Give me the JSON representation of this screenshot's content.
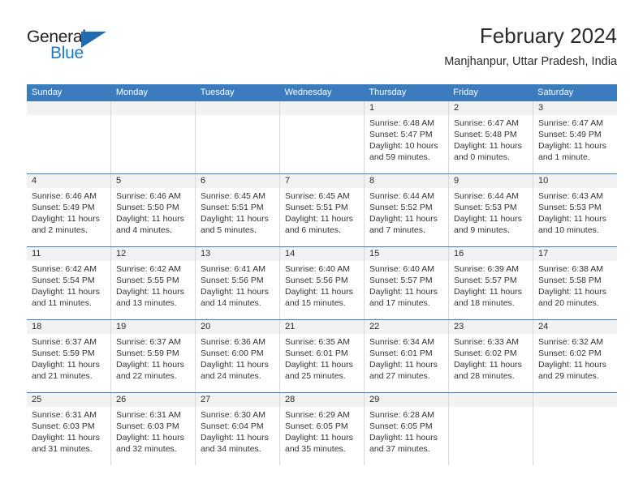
{
  "brand": {
    "name_top": "General",
    "name_bottom": "Blue",
    "accent_color": "#1f7ac4",
    "triangle_color": "#1f6cb4"
  },
  "header": {
    "title": "February 2024",
    "location": "Manjhanpur, Uttar Pradesh, India"
  },
  "theme": {
    "header_blue": "#3a7cbe",
    "daynum_band": "#f2f2f2",
    "cell_border": "#d9d9d9",
    "text": "#333333"
  },
  "weekdays": [
    "Sunday",
    "Monday",
    "Tuesday",
    "Wednesday",
    "Thursday",
    "Friday",
    "Saturday"
  ],
  "weeks": [
    [
      {
        "day": "",
        "sunrise": "",
        "sunset": "",
        "daylight_1": "",
        "daylight_2": ""
      },
      {
        "day": "",
        "sunrise": "",
        "sunset": "",
        "daylight_1": "",
        "daylight_2": ""
      },
      {
        "day": "",
        "sunrise": "",
        "sunset": "",
        "daylight_1": "",
        "daylight_2": ""
      },
      {
        "day": "",
        "sunrise": "",
        "sunset": "",
        "daylight_1": "",
        "daylight_2": ""
      },
      {
        "day": "1",
        "sunrise": "Sunrise: 6:48 AM",
        "sunset": "Sunset: 5:47 PM",
        "daylight_1": "Daylight: 10 hours",
        "daylight_2": "and 59 minutes."
      },
      {
        "day": "2",
        "sunrise": "Sunrise: 6:47 AM",
        "sunset": "Sunset: 5:48 PM",
        "daylight_1": "Daylight: 11 hours",
        "daylight_2": "and 0 minutes."
      },
      {
        "day": "3",
        "sunrise": "Sunrise: 6:47 AM",
        "sunset": "Sunset: 5:49 PM",
        "daylight_1": "Daylight: 11 hours",
        "daylight_2": "and 1 minute."
      }
    ],
    [
      {
        "day": "4",
        "sunrise": "Sunrise: 6:46 AM",
        "sunset": "Sunset: 5:49 PM",
        "daylight_1": "Daylight: 11 hours",
        "daylight_2": "and 2 minutes."
      },
      {
        "day": "5",
        "sunrise": "Sunrise: 6:46 AM",
        "sunset": "Sunset: 5:50 PM",
        "daylight_1": "Daylight: 11 hours",
        "daylight_2": "and 4 minutes."
      },
      {
        "day": "6",
        "sunrise": "Sunrise: 6:45 AM",
        "sunset": "Sunset: 5:51 PM",
        "daylight_1": "Daylight: 11 hours",
        "daylight_2": "and 5 minutes."
      },
      {
        "day": "7",
        "sunrise": "Sunrise: 6:45 AM",
        "sunset": "Sunset: 5:51 PM",
        "daylight_1": "Daylight: 11 hours",
        "daylight_2": "and 6 minutes."
      },
      {
        "day": "8",
        "sunrise": "Sunrise: 6:44 AM",
        "sunset": "Sunset: 5:52 PM",
        "daylight_1": "Daylight: 11 hours",
        "daylight_2": "and 7 minutes."
      },
      {
        "day": "9",
        "sunrise": "Sunrise: 6:44 AM",
        "sunset": "Sunset: 5:53 PM",
        "daylight_1": "Daylight: 11 hours",
        "daylight_2": "and 9 minutes."
      },
      {
        "day": "10",
        "sunrise": "Sunrise: 6:43 AM",
        "sunset": "Sunset: 5:53 PM",
        "daylight_1": "Daylight: 11 hours",
        "daylight_2": "and 10 minutes."
      }
    ],
    [
      {
        "day": "11",
        "sunrise": "Sunrise: 6:42 AM",
        "sunset": "Sunset: 5:54 PM",
        "daylight_1": "Daylight: 11 hours",
        "daylight_2": "and 11 minutes."
      },
      {
        "day": "12",
        "sunrise": "Sunrise: 6:42 AM",
        "sunset": "Sunset: 5:55 PM",
        "daylight_1": "Daylight: 11 hours",
        "daylight_2": "and 13 minutes."
      },
      {
        "day": "13",
        "sunrise": "Sunrise: 6:41 AM",
        "sunset": "Sunset: 5:56 PM",
        "daylight_1": "Daylight: 11 hours",
        "daylight_2": "and 14 minutes."
      },
      {
        "day": "14",
        "sunrise": "Sunrise: 6:40 AM",
        "sunset": "Sunset: 5:56 PM",
        "daylight_1": "Daylight: 11 hours",
        "daylight_2": "and 15 minutes."
      },
      {
        "day": "15",
        "sunrise": "Sunrise: 6:40 AM",
        "sunset": "Sunset: 5:57 PM",
        "daylight_1": "Daylight: 11 hours",
        "daylight_2": "and 17 minutes."
      },
      {
        "day": "16",
        "sunrise": "Sunrise: 6:39 AM",
        "sunset": "Sunset: 5:57 PM",
        "daylight_1": "Daylight: 11 hours",
        "daylight_2": "and 18 minutes."
      },
      {
        "day": "17",
        "sunrise": "Sunrise: 6:38 AM",
        "sunset": "Sunset: 5:58 PM",
        "daylight_1": "Daylight: 11 hours",
        "daylight_2": "and 20 minutes."
      }
    ],
    [
      {
        "day": "18",
        "sunrise": "Sunrise: 6:37 AM",
        "sunset": "Sunset: 5:59 PM",
        "daylight_1": "Daylight: 11 hours",
        "daylight_2": "and 21 minutes."
      },
      {
        "day": "19",
        "sunrise": "Sunrise: 6:37 AM",
        "sunset": "Sunset: 5:59 PM",
        "daylight_1": "Daylight: 11 hours",
        "daylight_2": "and 22 minutes."
      },
      {
        "day": "20",
        "sunrise": "Sunrise: 6:36 AM",
        "sunset": "Sunset: 6:00 PM",
        "daylight_1": "Daylight: 11 hours",
        "daylight_2": "and 24 minutes."
      },
      {
        "day": "21",
        "sunrise": "Sunrise: 6:35 AM",
        "sunset": "Sunset: 6:01 PM",
        "daylight_1": "Daylight: 11 hours",
        "daylight_2": "and 25 minutes."
      },
      {
        "day": "22",
        "sunrise": "Sunrise: 6:34 AM",
        "sunset": "Sunset: 6:01 PM",
        "daylight_1": "Daylight: 11 hours",
        "daylight_2": "and 27 minutes."
      },
      {
        "day": "23",
        "sunrise": "Sunrise: 6:33 AM",
        "sunset": "Sunset: 6:02 PM",
        "daylight_1": "Daylight: 11 hours",
        "daylight_2": "and 28 minutes."
      },
      {
        "day": "24",
        "sunrise": "Sunrise: 6:32 AM",
        "sunset": "Sunset: 6:02 PM",
        "daylight_1": "Daylight: 11 hours",
        "daylight_2": "and 29 minutes."
      }
    ],
    [
      {
        "day": "25",
        "sunrise": "Sunrise: 6:31 AM",
        "sunset": "Sunset: 6:03 PM",
        "daylight_1": "Daylight: 11 hours",
        "daylight_2": "and 31 minutes."
      },
      {
        "day": "26",
        "sunrise": "Sunrise: 6:31 AM",
        "sunset": "Sunset: 6:03 PM",
        "daylight_1": "Daylight: 11 hours",
        "daylight_2": "and 32 minutes."
      },
      {
        "day": "27",
        "sunrise": "Sunrise: 6:30 AM",
        "sunset": "Sunset: 6:04 PM",
        "daylight_1": "Daylight: 11 hours",
        "daylight_2": "and 34 minutes."
      },
      {
        "day": "28",
        "sunrise": "Sunrise: 6:29 AM",
        "sunset": "Sunset: 6:05 PM",
        "daylight_1": "Daylight: 11 hours",
        "daylight_2": "and 35 minutes."
      },
      {
        "day": "29",
        "sunrise": "Sunrise: 6:28 AM",
        "sunset": "Sunset: 6:05 PM",
        "daylight_1": "Daylight: 11 hours",
        "daylight_2": "and 37 minutes."
      },
      {
        "day": "",
        "sunrise": "",
        "sunset": "",
        "daylight_1": "",
        "daylight_2": ""
      },
      {
        "day": "",
        "sunrise": "",
        "sunset": "",
        "daylight_1": "",
        "daylight_2": ""
      }
    ]
  ]
}
